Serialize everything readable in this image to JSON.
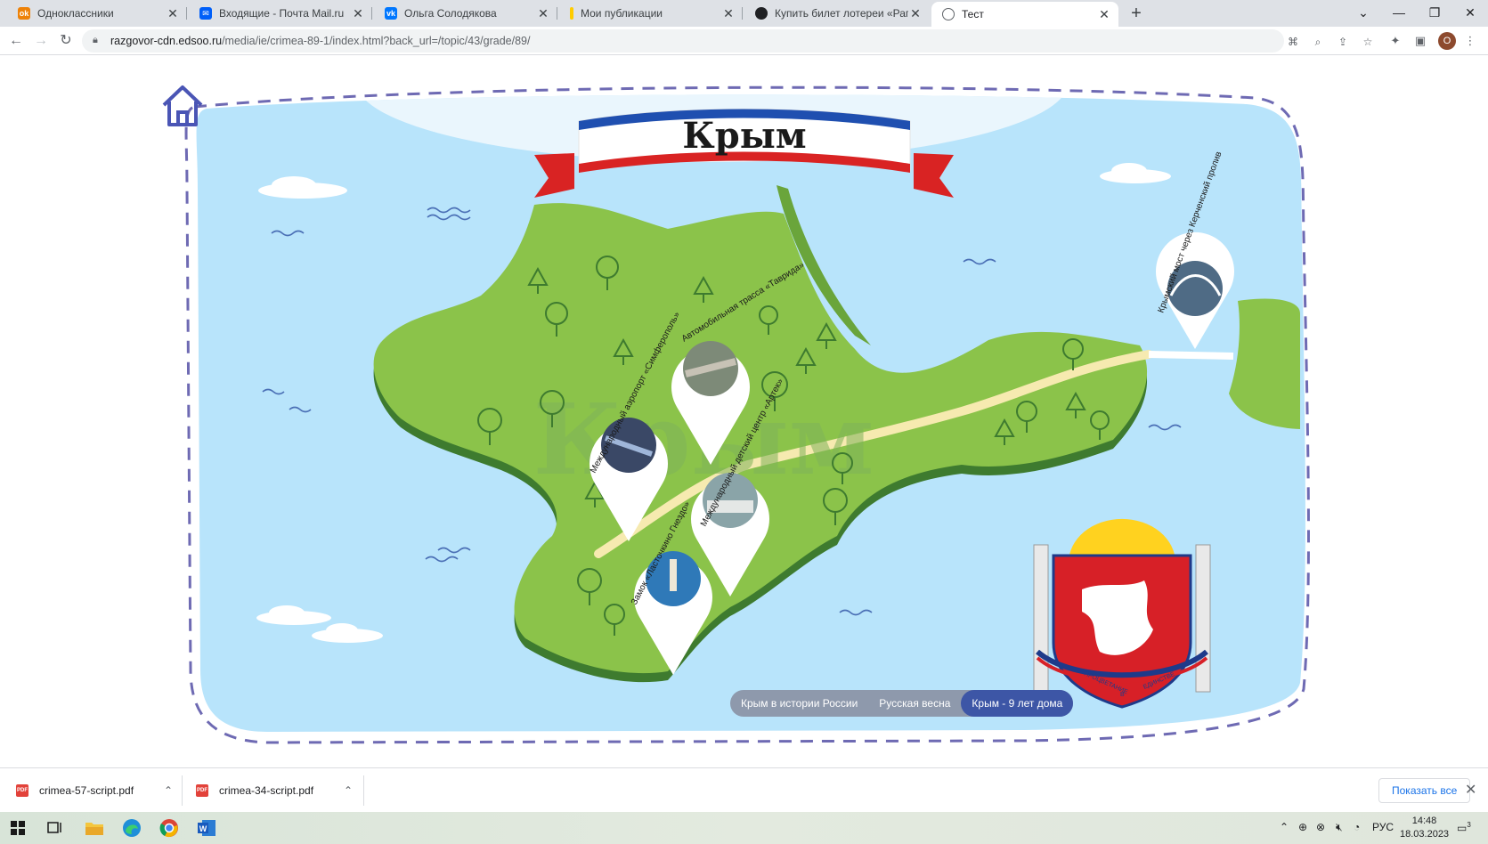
{
  "browser": {
    "tabs": [
      {
        "title": "Одноклассники",
        "icon": "ok-icon",
        "color": "#ee8208"
      },
      {
        "title": "Входящие - Почта Mail.ru",
        "icon": "mail-icon",
        "color": "#005ff9"
      },
      {
        "title": "Ольга Солодякова",
        "icon": "vk-icon",
        "color": "#0077ff"
      },
      {
        "title": "Мои публикации",
        "icon": "zen-icon",
        "color": "#ffcc00"
      },
      {
        "title": "Купить билет лотереи «Рапидо»",
        "icon": "lottery-icon",
        "color": "#202124"
      },
      {
        "title": "Тест",
        "icon": "globe-icon",
        "color": "#5f6368"
      }
    ],
    "url_host": "razgovor-cdn.edsoo.ru",
    "url_path": "/media/ie/crimea-89-1/index.html?back_url=/topic/43/grade/89/",
    "profile_initial": "O"
  },
  "page": {
    "title": "Крым",
    "watermark": "Крым",
    "pins": [
      {
        "label": "Автомобильная трасса «Таврида»"
      },
      {
        "label": "Международный аэропорт «Симферополь»"
      },
      {
        "label": "Международный детский центр «Артек»"
      },
      {
        "label": "Замок «Ласточкино Гнездо»"
      },
      {
        "label": "Крымский мост через Керченский пролив"
      }
    ],
    "coat_motto_left": "ПРОЦВЕТАНИЕ",
    "coat_motto_mid": "В",
    "coat_motto_right": "ЕДИНСТВЕ",
    "nav_tabs": [
      {
        "label": "Крым в истории России",
        "active": false
      },
      {
        "label": "Русская весна",
        "active": false
      },
      {
        "label": "Крым - 9 лет дома",
        "active": true
      }
    ],
    "colors": {
      "sea": "#b8e4fb",
      "land": "#8bc34a",
      "border": "#6e6ab3",
      "active_tab": "#3d56a6"
    }
  },
  "downloads": {
    "items": [
      {
        "name": "crimea-57-script.pdf"
      },
      {
        "name": "crimea-34-script.pdf"
      }
    ],
    "show_all": "Показать все"
  },
  "taskbar": {
    "lang": "РУС",
    "time": "14:48",
    "date": "18.03.2023",
    "notifications": "3"
  }
}
